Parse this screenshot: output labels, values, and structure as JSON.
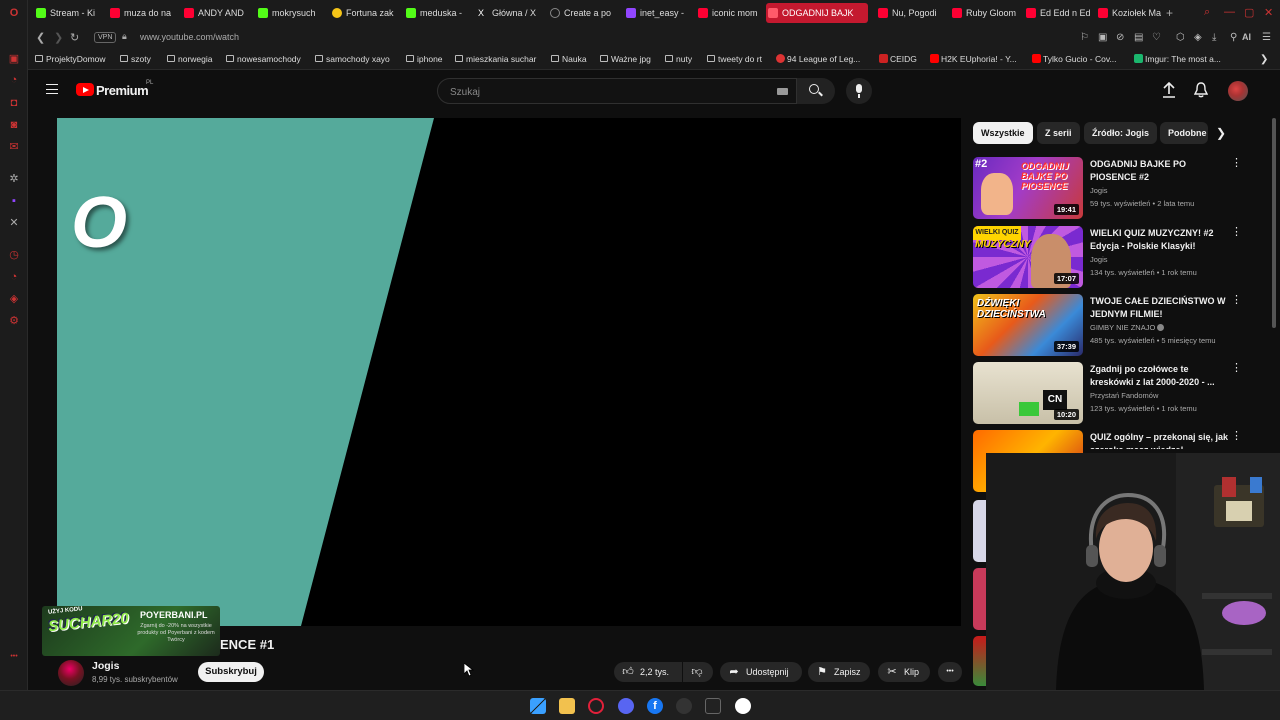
{
  "browser": {
    "tabs": [
      {
        "label": "Stream - Ki",
        "color": "#53fc18"
      },
      {
        "label": "muza do na",
        "color": "#ff0033"
      },
      {
        "label": "ANDY AND",
        "color": "#ff0033"
      },
      {
        "label": "mokrysuch",
        "color": "#53fc18"
      },
      {
        "label": "Fortuna zak",
        "color": "#f5c518"
      },
      {
        "label": "meduska -",
        "color": "#53fc18"
      },
      {
        "label": "Główna / X",
        "color": "#ffffff"
      },
      {
        "label": "Create a po",
        "color": "#888888"
      },
      {
        "label": "inet_easy -",
        "color": "#9146ff"
      },
      {
        "label": "iconic mom",
        "color": "#ff0033"
      },
      {
        "label": "ODGADNIJ BAJK",
        "color": "#ff0033",
        "active": true
      },
      {
        "label": "Nu, Pogodi",
        "color": "#ff0033"
      },
      {
        "label": "Ruby Gloom",
        "color": "#ff0033"
      },
      {
        "label": "Ed Edd n Ed",
        "color": "#ff0033"
      },
      {
        "label": "Koziołek Ma",
        "color": "#ff0033"
      }
    ],
    "new_tab": "+",
    "vpn": "VPN",
    "url": "www.youtube.com/watch",
    "toolbar_ai": "AI",
    "bookmarks": [
      {
        "label": "ProjektyDomow",
        "kind": "folder"
      },
      {
        "label": "szoty",
        "kind": "folder"
      },
      {
        "label": "norwegia",
        "kind": "folder"
      },
      {
        "label": "nowesamochody",
        "kind": "folder"
      },
      {
        "label": "samochody xayo",
        "kind": "folder"
      },
      {
        "label": "iphone",
        "kind": "folder"
      },
      {
        "label": "mieszkania suchar",
        "kind": "folder"
      },
      {
        "label": "Nauka",
        "kind": "folder"
      },
      {
        "label": "Ważne jpg",
        "kind": "folder"
      },
      {
        "label": "nuty",
        "kind": "folder"
      },
      {
        "label": "tweety do rt",
        "kind": "folder"
      },
      {
        "label": "94 League of Leg...",
        "kind": "site",
        "color": "#d33"
      },
      {
        "label": "CEIDG",
        "kind": "site",
        "color": "#c22"
      },
      {
        "label": "H2K EUphoria! - Y...",
        "kind": "site",
        "color": "#f00"
      },
      {
        "label": "Tylko Gucio - Cov...",
        "kind": "site",
        "color": "#f00"
      },
      {
        "label": "Imgur: The most a...",
        "kind": "site",
        "color": "#1bb76e"
      }
    ]
  },
  "youtube": {
    "logo_text": "Premium",
    "region": "PL",
    "search_placeholder": "Szukaj",
    "video": {
      "overlay_letter": "O",
      "title_visible": "ENCE #1",
      "channel_name": "Jogis",
      "channel_subs": "8,99 tys. subskrybentów",
      "subscribe_label": "Subskrybuj",
      "likes": "2,2 tys.",
      "share_label": "Udostępnij",
      "save_label": "Zapisz",
      "clip_label": "Klip",
      "more_label": "•••"
    },
    "ad": {
      "code": "SUCHAR20",
      "code_prefix": "UŻYJ KODU",
      "brand": "POYERBANI.PL",
      "text": "Zgarnij do -20% na wszystkie produkty od Poyerbani z kodem Twórcy"
    },
    "chips": [
      {
        "label": "Wszystkie",
        "active": true
      },
      {
        "label": "Z serii"
      },
      {
        "label": "Źródło: Jogis"
      },
      {
        "label": "Podobne"
      }
    ],
    "recommendations": [
      {
        "title": "ODGADNIJ BAJKE PO PIOSENCE #2",
        "channel": "Jogis",
        "meta": "59 tys. wyświetleń • 2 lata temu",
        "duration": "19:41",
        "rank": "#2",
        "thumb_text": "ODGADNIJ BAJKE PO PIOSENCE",
        "verified": false
      },
      {
        "title": "WIELKI QUIZ MUZYCZNY! #2 Edycja - Polskie Klasyki!",
        "channel": "Jogis",
        "meta": "134 tys. wyświetleń • 1 rok temu",
        "duration": "17:07",
        "thumb_text": "MUZYCZNY",
        "verified": false
      },
      {
        "title": "TWOJE CAŁE DZIECIŃSTWO W JEDNYM FILMIE!",
        "channel": "GIMBY NIE ZNAJO",
        "meta": "485 tys. wyświetleń • 5 miesięcy temu",
        "duration": "37:39",
        "thumb_text": "DŹWIĘKI DZIECIŃSTWA",
        "verified": true
      },
      {
        "title": "Zgadnij po czołówce te kreskówki z lat 2000-2020 - ...",
        "channel": "Przystań Fandomów",
        "meta": "123 tys. wyświetleń • 1 rok temu",
        "duration": "10:20",
        "thumb_text": "CN",
        "verified": false
      },
      {
        "title": "QUIZ ogólny – przekonaj się, jak szeroką masz wiedzę!",
        "channel": "",
        "meta": "",
        "duration": "",
        "thumb_text": "",
        "verified": false
      }
    ]
  },
  "colors": {
    "teal": "#55aa9b",
    "accent": "#ff0000",
    "active_tab": "#c4192f"
  }
}
